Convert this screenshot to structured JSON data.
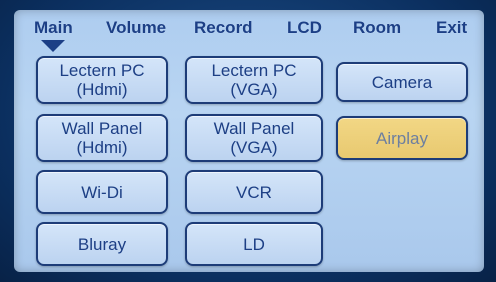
{
  "tabs": [
    {
      "label": "Main"
    },
    {
      "label": "Volume"
    },
    {
      "label": "Record"
    },
    {
      "label": "LCD"
    },
    {
      "label": "Room"
    },
    {
      "label": "Exit"
    }
  ],
  "buttons": {
    "lectern_pc_hdmi": {
      "line1": "Lectern PC",
      "line2": "(Hdmi)"
    },
    "lectern_pc_vga": {
      "line1": "Lectern PC",
      "line2": "(VGA)"
    },
    "camera": {
      "label": "Camera"
    },
    "wall_panel_hdmi": {
      "line1": "Wall Panel",
      "line2": "(Hdmi)"
    },
    "wall_panel_vga": {
      "line1": "Wall Panel",
      "line2": "(VGA)"
    },
    "airplay": {
      "label": "Airplay"
    },
    "wi_di": {
      "label": "Wi-Di"
    },
    "vcr": {
      "label": "VCR"
    },
    "bluray": {
      "label": "Bluray"
    },
    "ld": {
      "label": "LD"
    }
  },
  "active_button": "airplay",
  "colors": {
    "bezel": "#0b2f5f",
    "screen": "#b9d5f2",
    "text": "#1d3f85",
    "button_border": "#1d3c78",
    "active_button": "#e8c970"
  }
}
